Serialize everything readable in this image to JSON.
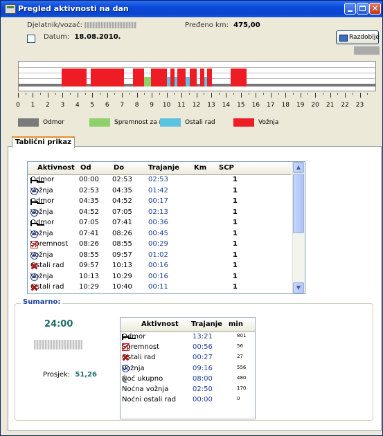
{
  "window": {
    "title": "Pregled aktivnosti na dan"
  },
  "header": {
    "driver_label": "Djelatnik/vozač:",
    "distance_label": "Pređeno km:",
    "distance_value": "475,00",
    "date_label": "Datum:",
    "date_value": "18.08.2010.",
    "period_button": "Razdoblje"
  },
  "timeline": {
    "hours": [
      "0",
      "1",
      "2",
      "3",
      "4",
      "5",
      "6",
      "7",
      "8",
      "9",
      "10",
      "11",
      "12",
      "13",
      "14",
      "15",
      "16",
      "17",
      "18",
      "19",
      "20",
      "21",
      "22",
      "23"
    ]
  },
  "legend": [
    {
      "label": "Odmor",
      "color": "#7a7a7a"
    },
    {
      "label": "Spremnost za rad",
      "color": "#8ed06a"
    },
    {
      "label": "Ostali rad",
      "color": "#5bc2e0"
    },
    {
      "label": "Vožnja",
      "color": "#ee1c24"
    }
  ],
  "tab": {
    "label": "Tablični prikaz"
  },
  "table": {
    "columns": [
      "Aktivnost",
      "Od",
      "Do",
      "Trajanje",
      "Km",
      "SCP"
    ],
    "rows": [
      {
        "activity": "Odmor",
        "icon": "bed-icon",
        "from": "00:00",
        "to": "02:53",
        "duration": "02:53",
        "km": "",
        "scp": "1"
      },
      {
        "activity": "Vožnja",
        "icon": "steering-wheel-icon",
        "from": "02:53",
        "to": "04:35",
        "duration": "01:42",
        "km": "",
        "scp": "1"
      },
      {
        "activity": "Odmor",
        "icon": "bed-icon",
        "from": "04:35",
        "to": "04:52",
        "duration": "00:17",
        "km": "",
        "scp": "1"
      },
      {
        "activity": "Vožnja",
        "icon": "steering-wheel-icon",
        "from": "04:52",
        "to": "07:05",
        "duration": "02:13",
        "km": "",
        "scp": "1"
      },
      {
        "activity": "Odmor",
        "icon": "bed-icon",
        "from": "07:05",
        "to": "07:41",
        "duration": "00:36",
        "km": "",
        "scp": "1"
      },
      {
        "activity": "Vožnja",
        "icon": "steering-wheel-icon",
        "from": "07:41",
        "to": "08:26",
        "duration": "00:45",
        "km": "",
        "scp": "1"
      },
      {
        "activity": "Spremnost",
        "icon": "availability-icon",
        "from": "08:26",
        "to": "08:55",
        "duration": "00:29",
        "km": "",
        "scp": "1"
      },
      {
        "activity": "Vožnja",
        "icon": "steering-wheel-icon",
        "from": "08:55",
        "to": "09:57",
        "duration": "01:02",
        "km": "",
        "scp": "1"
      },
      {
        "activity": "Ostali rad",
        "icon": "crossed-hammers-icon",
        "from": "09:57",
        "to": "10:13",
        "duration": "00:16",
        "km": "",
        "scp": "1"
      },
      {
        "activity": "Vožnja",
        "icon": "steering-wheel-icon",
        "from": "10:13",
        "to": "10:29",
        "duration": "00:16",
        "km": "",
        "scp": "1"
      },
      {
        "activity": "Ostali rad",
        "icon": "crossed-hammers-icon",
        "from": "10:29",
        "to": "10:40",
        "duration": "00:11",
        "km": "",
        "scp": "1"
      }
    ]
  },
  "summary": {
    "legend": "Sumarno:",
    "total": "24:00",
    "average_label": "Prosjek:",
    "average_value": "51,26",
    "columns": [
      "Aktivnost",
      "Trajanje",
      "min"
    ],
    "rows": [
      {
        "activity": "Odmor",
        "icon": "bed-icon",
        "duration": "13:21",
        "min": "801"
      },
      {
        "activity": "Spremnost",
        "icon": "availability-icon",
        "duration": "00:56",
        "min": "56"
      },
      {
        "activity": "Ostali rad",
        "icon": "crossed-hammers-icon",
        "duration": "00:27",
        "min": "27"
      },
      {
        "activity": "Vožnja",
        "icon": "steering-wheel-icon",
        "duration": "09:16",
        "min": "556"
      },
      {
        "activity": "Noć ukupno",
        "icon": "moon-icon",
        "duration": "08:00",
        "min": "480"
      },
      {
        "activity": "Noćna vožnja",
        "icon": "",
        "duration": "02:50",
        "min": "170"
      },
      {
        "activity": "Noćni ostali rad",
        "icon": "",
        "duration": "00:00",
        "min": "0"
      }
    ]
  }
}
